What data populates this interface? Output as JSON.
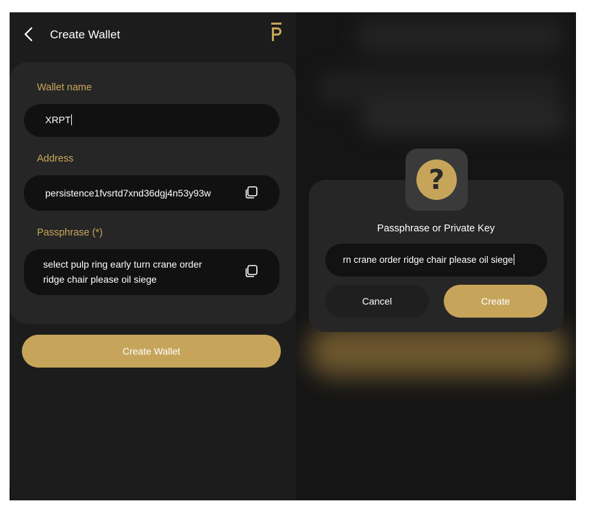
{
  "left_screen": {
    "header": {
      "title": "Create Wallet",
      "back_icon": "chevron-left-icon",
      "logo_icon": "persistence-logo-icon"
    },
    "form": {
      "wallet_name": {
        "label": "Wallet name",
        "value": "XRPT"
      },
      "address": {
        "label": "Address",
        "value": "persistence1fvsrtd7xnd36dgj4n53y93w",
        "icon": "copy-icon"
      },
      "passphrase": {
        "label": "Passphrase (*)",
        "line1": "select pulp ring early turn crane order",
        "line2": "ridge chair please oil siege",
        "icon": "copy-icon"
      }
    },
    "create_button": "Create Wallet"
  },
  "dialog": {
    "icon": "question-icon",
    "icon_glyph": "?",
    "title": "Passphrase or Private Key",
    "input_value": "rn crane order ridge chair please oil siege",
    "cancel_label": "Cancel",
    "create_label": "Create"
  },
  "colors": {
    "accent": "#c6a55b",
    "background": "#1c1c1c",
    "card": "#262626",
    "field": "#111111",
    "text": "#ffffff"
  }
}
